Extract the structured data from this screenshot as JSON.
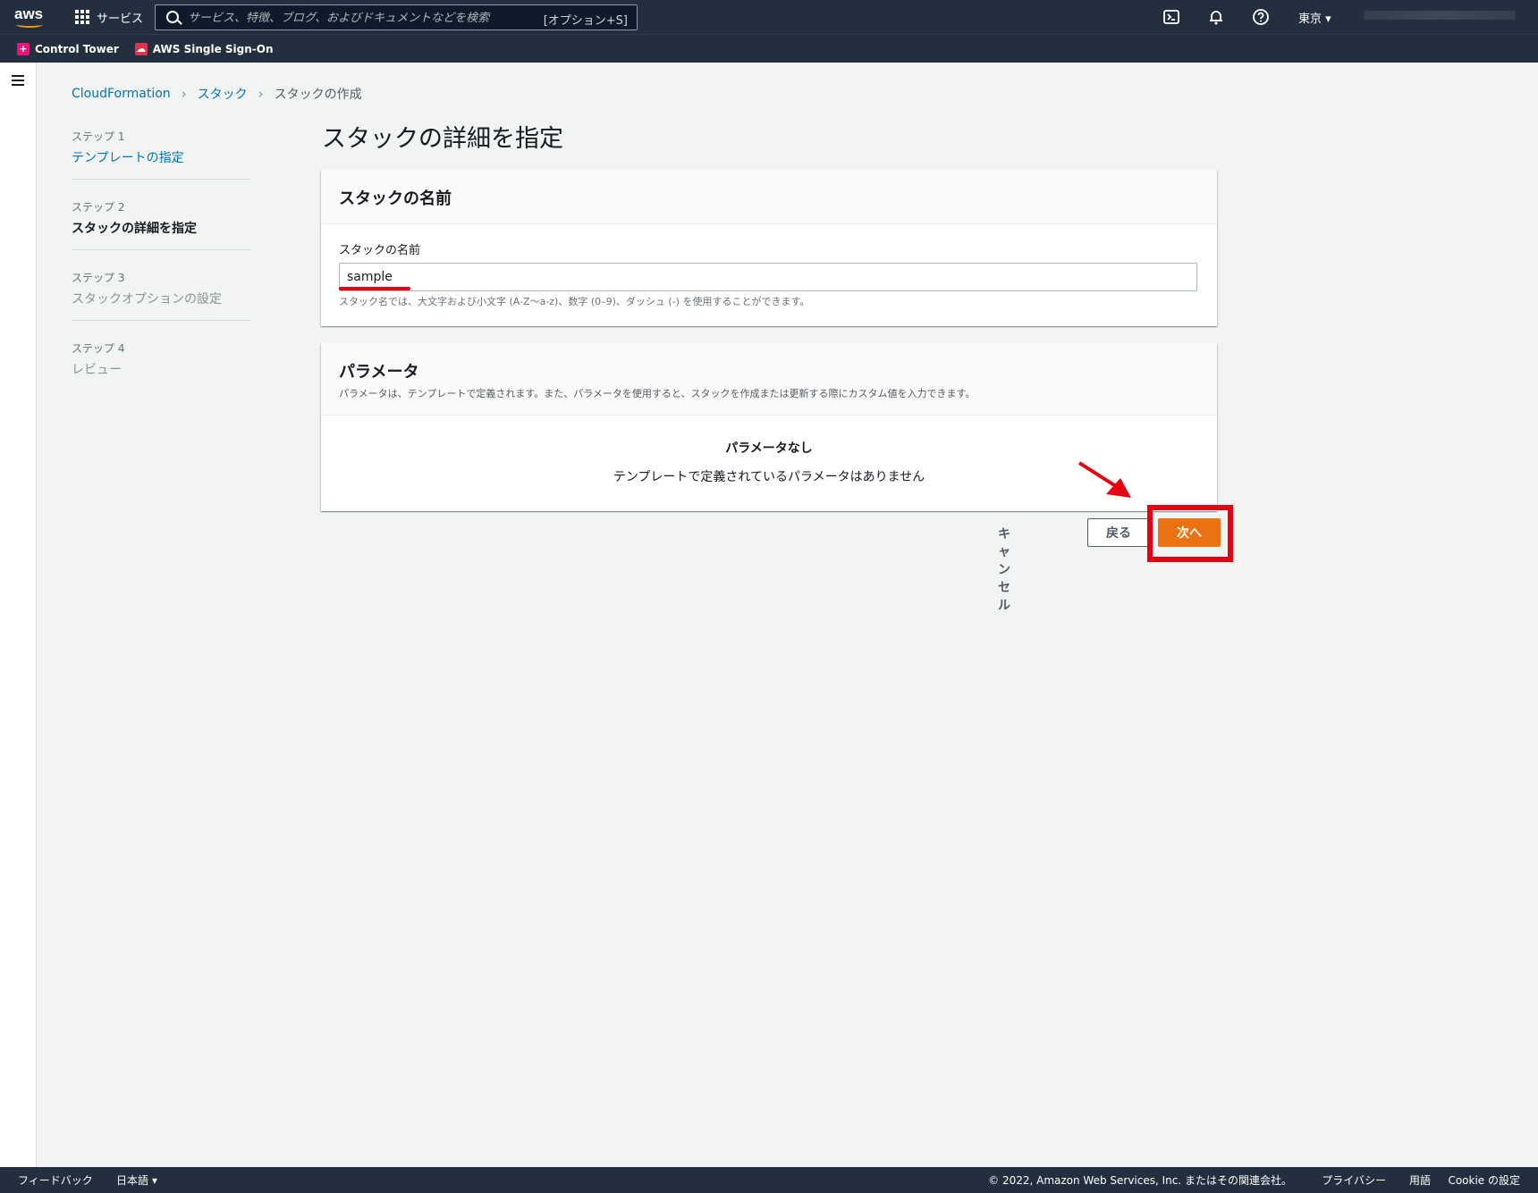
{
  "topbar": {
    "logo_text": "aws",
    "services_label": "サービス",
    "search_placeholder": "サービス、特徴、ブログ、およびドキュメントなどを検索",
    "search_shortcut": "[オプション+S]",
    "region": "東京 ▾"
  },
  "favorites": [
    {
      "label": "Control Tower",
      "icon": "control-tower-icon"
    },
    {
      "label": "AWS Single Sign-On",
      "icon": "sso-icon"
    }
  ],
  "breadcrumb": {
    "item1": "CloudFormation",
    "item2": "スタック",
    "current": "スタックの作成"
  },
  "steps": [
    {
      "num": "ステップ 1",
      "title": "テンプレートの指定",
      "state": "link"
    },
    {
      "num": "ステップ 2",
      "title": "スタックの詳細を指定",
      "state": "active"
    },
    {
      "num": "ステップ 3",
      "title": "スタックオプションの設定",
      "state": "disabled"
    },
    {
      "num": "ステップ 4",
      "title": "レビュー",
      "state": "disabled"
    }
  ],
  "page_title": "スタックの詳細を指定",
  "stack_name_card": {
    "title": "スタックの名前",
    "field_label": "スタックの名前",
    "value": "sample",
    "hint": "スタック名では、大文字および小文字 (A-Z〜a-z)、数字 (0–9)、ダッシュ (-) を使用することができます。"
  },
  "params_card": {
    "title": "パラメータ",
    "description": "パラメータは、テンプレートで定義されます。また、パラメータを使用すると、スタックを作成または更新する際にカスタム値を入力できます。",
    "empty_title": "パラメータなし",
    "empty_desc": "テンプレートで定義されているパラメータはありません"
  },
  "actions": {
    "cancel": "キャンセル",
    "back": "戻る",
    "next": "次へ"
  },
  "footer": {
    "feedback": "フィードバック",
    "language": "日本語 ▾",
    "copyright": "© 2022, Amazon Web Services, Inc. またはその関連会社。",
    "privacy": "プライバシー",
    "terms": "用語",
    "cookie": "Cookie の設定"
  },
  "colors": {
    "nav_bg": "#232f3e",
    "primary_button": "#ec7211",
    "link": "#0073bb",
    "annotation": "#e60012"
  }
}
